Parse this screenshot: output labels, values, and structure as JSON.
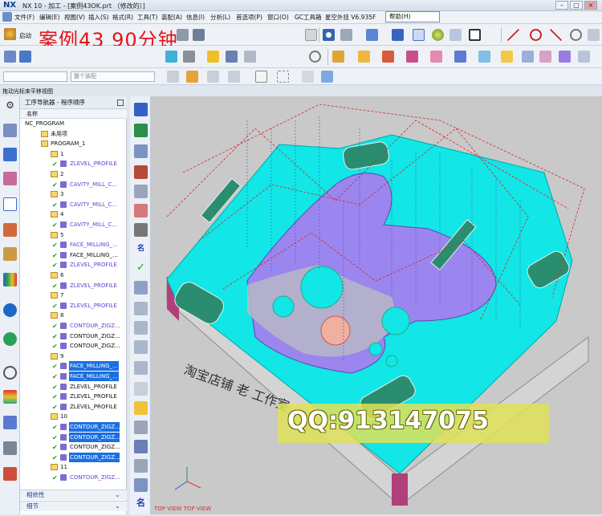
{
  "window": {
    "logo": "NX",
    "title": "NX 10 - 加工 - [案例43OK.prt （修改的）]",
    "controls": [
      "–",
      "□",
      "×"
    ]
  },
  "menubar": {
    "items": [
      "文件(F)",
      "编辑(E)",
      "视图(V)",
      "插入(S)",
      "格式(R)",
      "工具(T)",
      "装配(A)",
      "信息(I)",
      "分析(L)",
      "首选项(P)",
      "窗口(O)",
      "GC工具箱",
      "星空外挂 V6.935F"
    ],
    "help": "帮助(H)"
  },
  "toolbar": {
    "start_label": "启动",
    "overlay_banner": "案例43    90分钟",
    "filter_dropdown": "",
    "assembly_dropdown": "整个装配"
  },
  "status_hint": "拖动光标来平移视图",
  "navigator": {
    "title": "工序导航器 - 程序顺序",
    "column_header": "名称",
    "rows": [
      {
        "label": "NC_PROGRAM",
        "indent": 0,
        "type": "root",
        "style": ""
      },
      {
        "label": "未用项",
        "indent": 1,
        "type": "folder",
        "style": ""
      },
      {
        "label": "PROGRAM_1",
        "indent": 1,
        "type": "folder",
        "style": ""
      },
      {
        "label": "1",
        "indent": 2,
        "type": "folder",
        "style": ""
      },
      {
        "label": "ZLEVEL_PROFILE",
        "indent": 3,
        "type": "op",
        "style": "purple"
      },
      {
        "label": "2",
        "indent": 2,
        "type": "folder",
        "style": ""
      },
      {
        "label": "CAVITY_MILL_C...",
        "indent": 3,
        "type": "op",
        "style": "purple"
      },
      {
        "label": "3",
        "indent": 2,
        "type": "folder",
        "style": ""
      },
      {
        "label": "CAVITY_MILL_C...",
        "indent": 3,
        "type": "op",
        "style": "purple"
      },
      {
        "label": "4",
        "indent": 2,
        "type": "folder",
        "style": ""
      },
      {
        "label": "CAVITY_MILL_C...",
        "indent": 3,
        "type": "op",
        "style": "purple"
      },
      {
        "label": "5",
        "indent": 2,
        "type": "folder",
        "style": ""
      },
      {
        "label": "FACE_MILLING_...",
        "indent": 3,
        "type": "op",
        "style": "purple"
      },
      {
        "label": "FACE_MILLING_...",
        "indent": 3,
        "type": "op",
        "style": ""
      },
      {
        "label": "ZLEVEL_PROFILE",
        "indent": 3,
        "type": "op",
        "style": "purple"
      },
      {
        "label": "6",
        "indent": 2,
        "type": "folder",
        "style": ""
      },
      {
        "label": "ZLEVEL_PROFILE",
        "indent": 3,
        "type": "op",
        "style": "purple"
      },
      {
        "label": "7",
        "indent": 2,
        "type": "folder",
        "style": ""
      },
      {
        "label": "ZLEVEL_PROFILE",
        "indent": 3,
        "type": "op",
        "style": "purple"
      },
      {
        "label": "8",
        "indent": 2,
        "type": "folder",
        "style": ""
      },
      {
        "label": "CONTOUR_ZIGZ...",
        "indent": 3,
        "type": "op",
        "style": "purple"
      },
      {
        "label": "CONTOUR_ZIGZ...",
        "indent": 3,
        "type": "op",
        "style": ""
      },
      {
        "label": "CONTOUR_ZIGZ...",
        "indent": 3,
        "type": "op",
        "style": ""
      },
      {
        "label": "9",
        "indent": 2,
        "type": "folder",
        "style": ""
      },
      {
        "label": "FACE_MILLING_...",
        "indent": 3,
        "type": "op",
        "style": "sel"
      },
      {
        "label": "FACE_MILLING_...",
        "indent": 3,
        "type": "op",
        "style": "sel"
      },
      {
        "label": "ZLEVEL_PROFILE",
        "indent": 3,
        "type": "op",
        "style": ""
      },
      {
        "label": "ZLEVEL_PROFILE",
        "indent": 3,
        "type": "op",
        "style": ""
      },
      {
        "label": "ZLEVEL_PROFILE",
        "indent": 3,
        "type": "op",
        "style": ""
      },
      {
        "label": "10",
        "indent": 2,
        "type": "folder",
        "style": ""
      },
      {
        "label": "CONTOUR_ZIGZ...",
        "indent": 3,
        "type": "op",
        "style": "sel"
      },
      {
        "label": "CONTOUR_ZIGZ...",
        "indent": 3,
        "type": "op",
        "style": "sel"
      },
      {
        "label": "CONTOUR_ZIGZ...",
        "indent": 3,
        "type": "op",
        "style": ""
      },
      {
        "label": "CONTOUR_ZIGZ...",
        "indent": 3,
        "type": "op",
        "style": "sel"
      },
      {
        "label": "11",
        "indent": 2,
        "type": "folder",
        "style": ""
      },
      {
        "label": "CONTOUR_ZIGZ...",
        "indent": 3,
        "type": "op",
        "style": "purple"
      }
    ],
    "sections": [
      "相依性",
      "细节"
    ]
  },
  "viewport": {
    "view_label": "TOP VIEW    TOP VIEW",
    "part_engraving": "淘宝店铺  老  工作室",
    "watermark": "QQ:913147075"
  },
  "colors": {
    "accent": "#1c6fe0",
    "cyan_surface": "#12e6e6",
    "violet_surface": "#9a86ee",
    "toolpath": "#d9262b",
    "base_grey": "#d4d4d4",
    "side_magenta": "#b0407a"
  }
}
